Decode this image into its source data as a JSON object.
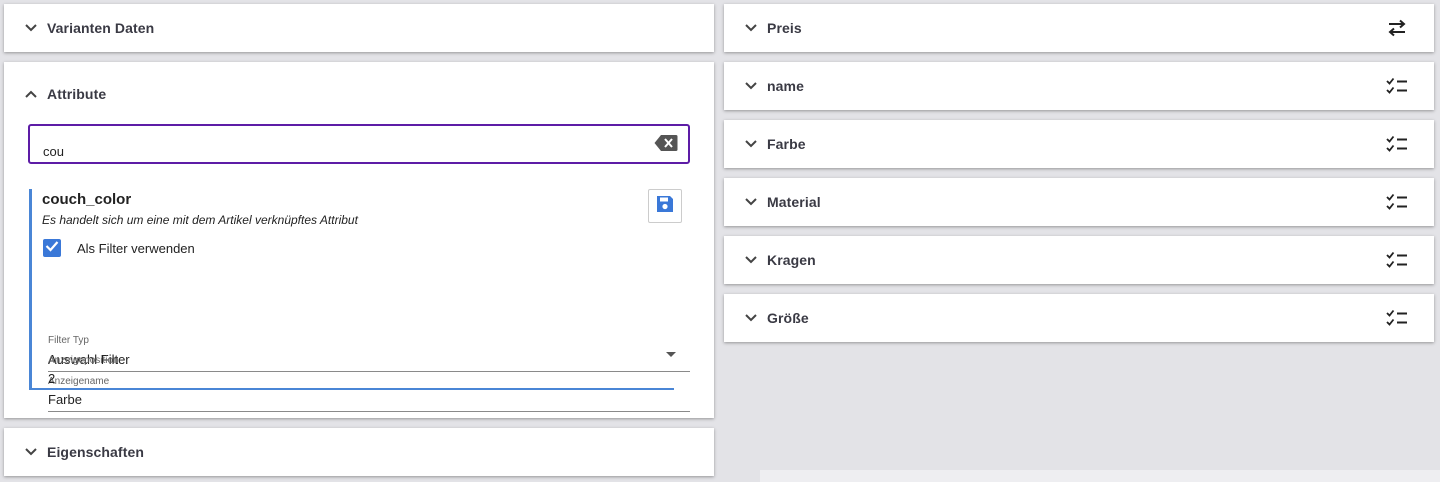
{
  "left_panels": {
    "variant_data": {
      "title": "Varianten Daten"
    },
    "attributes": {
      "title": "Attribute",
      "search": {
        "value": "cou"
      },
      "attribute": {
        "name": "couch_color",
        "description": "Es handelt sich um eine mit dem Artikel verknüpftes Attribut",
        "use_as_filter_label": "Als Filter verwenden",
        "use_as_filter_checked": true,
        "filter_type": {
          "label": "Filter Typ",
          "value": "Auswahl Filter"
        },
        "display_name": {
          "label": "Anzeigename",
          "value": "Farbe"
        },
        "display_position": {
          "label": "Anzeigeposition",
          "value": "2"
        }
      }
    },
    "properties": {
      "title": "Eigenschaften"
    }
  },
  "right_panels": [
    {
      "title": "Preis",
      "icon": "swap-horizontal-icon"
    },
    {
      "title": "name",
      "icon": "checklist-icon"
    },
    {
      "title": "Farbe",
      "icon": "checklist-icon"
    },
    {
      "title": "Material",
      "icon": "checklist-icon"
    },
    {
      "title": "Kragen",
      "icon": "checklist-icon"
    },
    {
      "title": "Größe",
      "icon": "checklist-icon"
    }
  ],
  "colors": {
    "search_border": "#5d1ca6",
    "accent_blue": "#4a86d6",
    "background": "#e3e3e7"
  }
}
